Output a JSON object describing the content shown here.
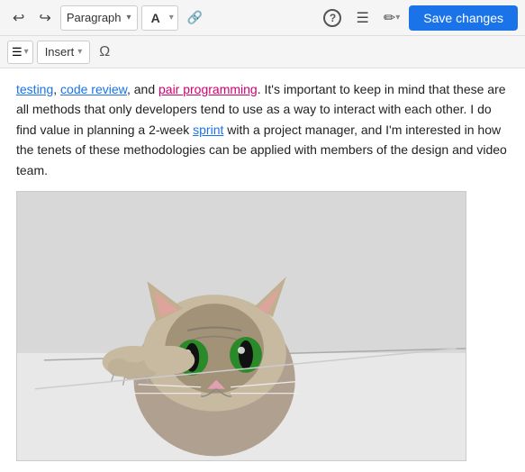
{
  "toolbar": {
    "save_label": "Save changes",
    "paragraph_label": "Paragraph",
    "undo_label": "Undo",
    "redo_label": "Redo",
    "font_format_label": "A",
    "link_label": "Link",
    "help_label": "?",
    "menu_label": "☰",
    "edit_label": "✏",
    "chevron": "▾"
  },
  "toolbar2": {
    "insert_label": "Insert",
    "omega_label": "Ω"
  },
  "content": {
    "text_segment1": "testing",
    "comma1": ", ",
    "text_segment2": "code review",
    "comma2": ", and ",
    "text_segment3": "pair programming",
    "text_main": ". It's important to keep in mind that these are all methods that only developers tend to use as a way to interact with each other. I do find value in planning a 2-week ",
    "sprint_link": "sprint",
    "text_end": " with a project manager, and I'm interested in how the tenets of these methodologies can be applied with members of the design and video team."
  },
  "image": {
    "alt": "Cat peeking over a surface"
  },
  "colors": {
    "save_bg": "#1a73e8",
    "link_blue": "#1a73e8",
    "link_pink": "#d0006f",
    "toolbar_bg": "#f5f5f5"
  }
}
